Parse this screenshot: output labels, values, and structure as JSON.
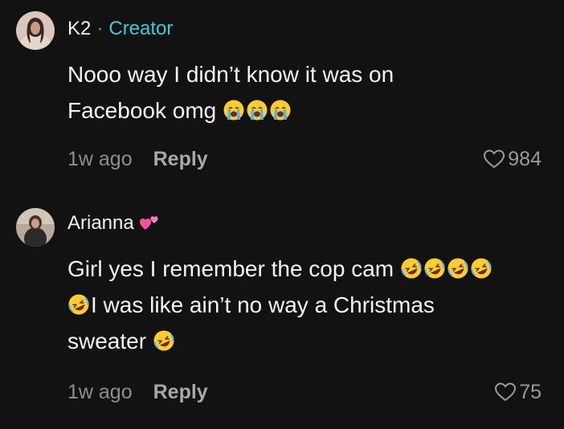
{
  "comments": [
    {
      "username": "K2",
      "separator": "·",
      "badge": "Creator",
      "name_emoji": null,
      "text_lines": [
        "Nooo way I didn’t know it was on",
        "Facebook omg"
      ],
      "trailing_emojis": [
        "loudly-crying-face",
        "loudly-crying-face",
        "loudly-crying-face"
      ],
      "time": "1w ago",
      "reply_label": "Reply",
      "likes": "984"
    },
    {
      "username": "Arianna",
      "name_emoji": "two-hearts",
      "text_line_1": "Girl yes I remember the cop cam",
      "text_line_1_emojis": [
        "rolling-on-floor-laughing",
        "rolling-on-floor-laughing",
        "rolling-on-floor-laughing",
        "rolling-on-floor-laughing"
      ],
      "text_line_2": "I was like ain’t no way a Christmas",
      "text_line_2_emojis": [
        "rolling-on-floor-laughing"
      ],
      "text_line_3": "sweater",
      "text_line_3_emojis": [
        "rolling-on-floor-laughing"
      ],
      "time": "1w ago",
      "reply_label": "Reply",
      "likes": "75"
    }
  ],
  "colors": {
    "background": "#121212",
    "creator_badge": "#3fc9dd",
    "muted_text": "#8e8e8e"
  }
}
